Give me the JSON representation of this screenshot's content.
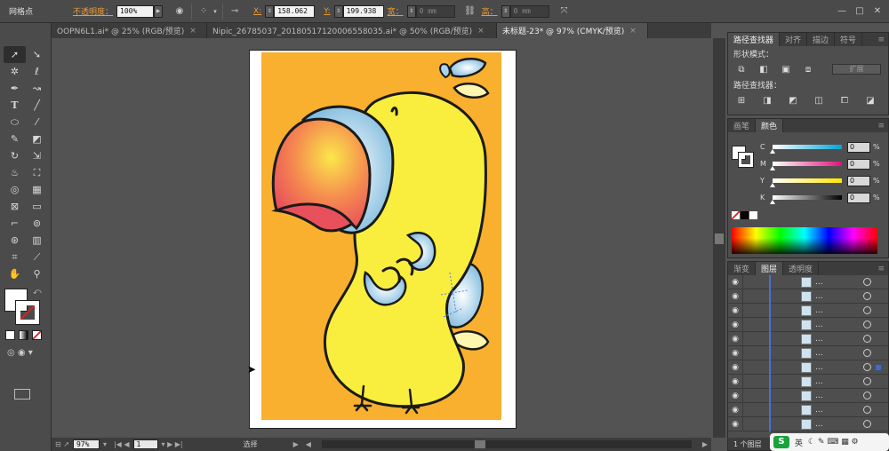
{
  "control_bar": {
    "mode_label": "网格点",
    "opacity_label": "不透明度：",
    "opacity_value": "100%",
    "x_label": "X:",
    "x_value": "158.062",
    "y_label": "Y:",
    "y_value": "199.938",
    "w_label": "宽：",
    "w_value": "0 mm",
    "h_label": "高：",
    "h_value": "0 mm",
    "window_buttons": [
      "—",
      "□",
      "✕"
    ]
  },
  "tabs": [
    {
      "label": "OOPN6L1.ai* @ 25% (RGB/预览)",
      "active": false
    },
    {
      "label": "Nipic_26785037_20180517120006558035.ai* @ 50% (RGB/预览)",
      "active": false
    },
    {
      "label": "未标题-23* @ 97% (CMYK/预览)",
      "active": true
    }
  ],
  "tab_close": "×",
  "pathfinder_panel": {
    "tabs": [
      "路径查找器",
      "对齐",
      "描边",
      "符号"
    ],
    "shape_modes_label": "形状模式：",
    "expand_label": "扩展",
    "pathfinders_label": "路径查找器："
  },
  "color_panel": {
    "tabs": [
      "画笔",
      "颜色"
    ],
    "channels": [
      {
        "label": "C",
        "value": "0",
        "pct": "%"
      },
      {
        "label": "M",
        "value": "0",
        "pct": "%"
      },
      {
        "label": "Y",
        "value": "0",
        "pct": "%"
      },
      {
        "label": "K",
        "value": "0",
        "pct": "%"
      }
    ]
  },
  "layers_panel": {
    "tabs": [
      "渐变",
      "图层",
      "透明度"
    ],
    "row_name": "...",
    "row_count": 11,
    "footer": "1 个图层"
  },
  "status_bar": {
    "zoom": "97%",
    "page": "1",
    "tool": "选择"
  },
  "ime": {
    "logo": "S",
    "lang": "英"
  },
  "colors": {
    "artboard_bg": "#f8b02e",
    "bird_body": "#f9ee3e",
    "outline": "#1a1a1a",
    "beak_red": "#e8505b",
    "beak_yellow": "#fbe74a",
    "feather_blue": "#7ab8dc",
    "accent_orange": "#e89b35"
  }
}
